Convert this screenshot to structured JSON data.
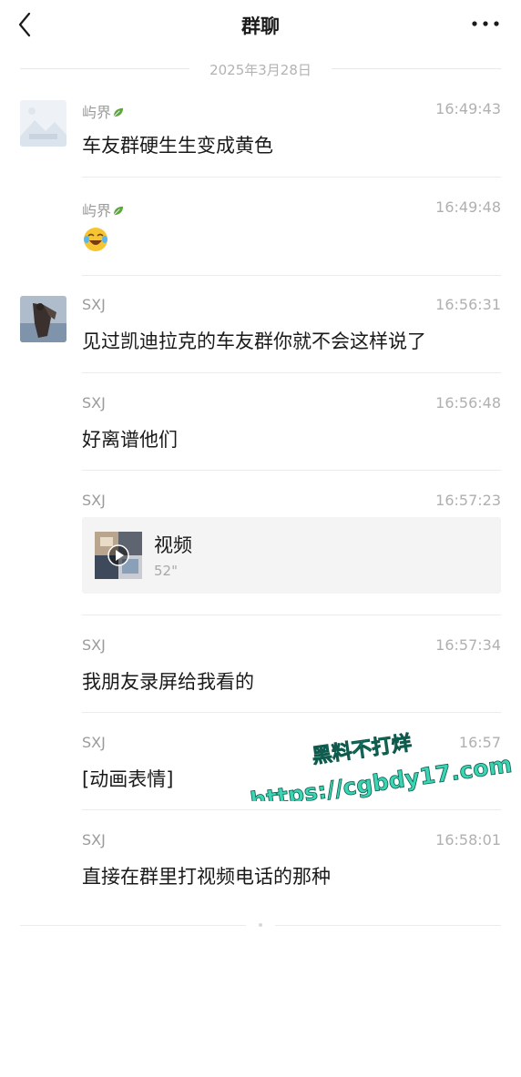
{
  "header": {
    "title": "群聊",
    "back_icon": "chevron-left-icon",
    "more_icon": "more-horizontal-icon"
  },
  "date_separator": "2025年3月28日",
  "messages": [
    {
      "sender": "屿界",
      "time": "16:49:43",
      "text": "车友群硬生生变成黄色",
      "has_avatar": true
    },
    {
      "sender": "屿界",
      "time": "16:49:48",
      "text": "",
      "emoji": "laughing-crying-emoji",
      "has_avatar": false
    },
    {
      "sender": "SXJ",
      "time": "16:56:31",
      "text": "见过凯迪拉克的车友群你就不会这样说了",
      "has_avatar": true
    },
    {
      "sender": "SXJ",
      "time": "16:56:48",
      "text": "好离谱他们",
      "has_avatar": false
    },
    {
      "sender": "SXJ",
      "time": "16:57:23",
      "video": {
        "title": "视频",
        "duration": "52\""
      },
      "has_avatar": false
    },
    {
      "sender": "SXJ",
      "time": "16:57:34",
      "text": "我朋友录屏给我看的",
      "has_avatar": false
    },
    {
      "sender": "SXJ",
      "time": "16:57",
      "text": "[动画表情]",
      "has_avatar": false
    },
    {
      "sender": "SXJ",
      "time": "16:58:01",
      "text": "直接在群里打视频电话的那种",
      "has_avatar": false
    }
  ],
  "watermark": {
    "line1": "黑料不打烊",
    "line2": "https://cgbdy17.com",
    "color": "#3ad6b4"
  }
}
